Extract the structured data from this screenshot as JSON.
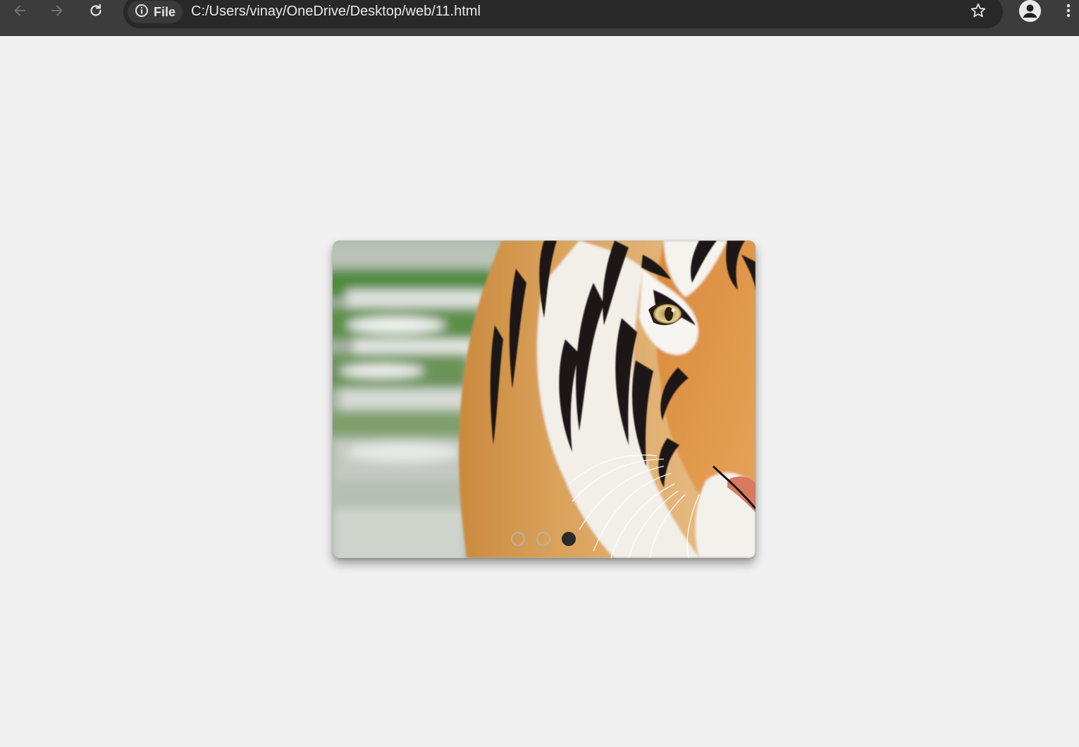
{
  "browser": {
    "address_bar": {
      "chip_label": "File",
      "url": "C:/Users/vinay/OneDrive/Desktop/web/11.html"
    },
    "icons": {
      "back": "back-arrow-icon",
      "forward": "forward-arrow-icon",
      "reload": "reload-icon",
      "info": "info-icon",
      "bookmark": "star-icon",
      "profile": "profile-avatar-icon",
      "menu": "kebab-menu-icon"
    }
  },
  "slider": {
    "image": "tiger-face-photo",
    "slide_count": 3,
    "active_index": 2,
    "dots": [
      {
        "state": "inactive"
      },
      {
        "state": "inactive"
      },
      {
        "state": "active"
      }
    ]
  },
  "colors": {
    "page_background": "#f0f0f0",
    "toolbar_background": "#3c3c3c",
    "omnibox_background": "#282828",
    "active_dot": "#2b2b2b"
  }
}
